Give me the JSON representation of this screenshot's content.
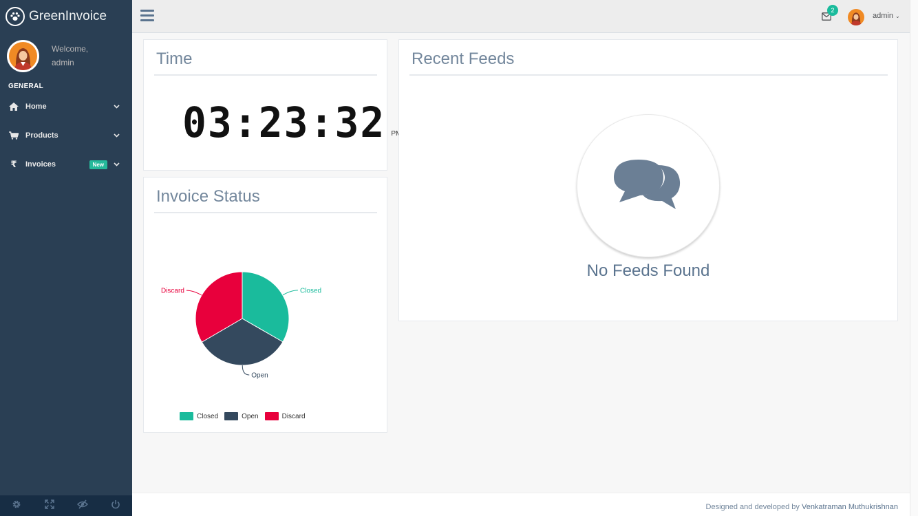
{
  "app": {
    "title": "GreenInvoice"
  },
  "profile": {
    "welcome": "Welcome,",
    "name": "admin"
  },
  "sidebar": {
    "section_title": "GENERAL",
    "items": [
      {
        "label": "Home",
        "icon": "home-icon",
        "badge": ""
      },
      {
        "label": "Products",
        "icon": "cart-icon",
        "badge": ""
      },
      {
        "label": "Invoices",
        "icon": "rupee-icon",
        "badge": "New"
      }
    ],
    "footer_icons": [
      "gear-icon",
      "fullscreen-icon",
      "eye-slash-icon",
      "power-icon"
    ]
  },
  "topnav": {
    "mail_count": "2",
    "user": "admin"
  },
  "time_panel": {
    "title": "Time",
    "time": "03:23:32",
    "ampm": "PM"
  },
  "invoice_panel": {
    "title": "Invoice Status",
    "chart_data": {
      "type": "pie",
      "categories": [
        "Closed",
        "Open",
        "Discard"
      ],
      "values": [
        33.3,
        33.3,
        33.4
      ],
      "colors": [
        "#1abb9c",
        "#34495e",
        "#e8003c"
      ],
      "legend": "bottom"
    }
  },
  "feeds_panel": {
    "title": "Recent Feeds",
    "empty_text": "No Feeds Found"
  },
  "footer": {
    "prefix": "Designed and developed by ",
    "author": "Venkatraman Muthukrishnan"
  },
  "colors": {
    "sidebar": "#2a3f54",
    "accent": "#1abb9c",
    "title_text": "#73879c"
  }
}
